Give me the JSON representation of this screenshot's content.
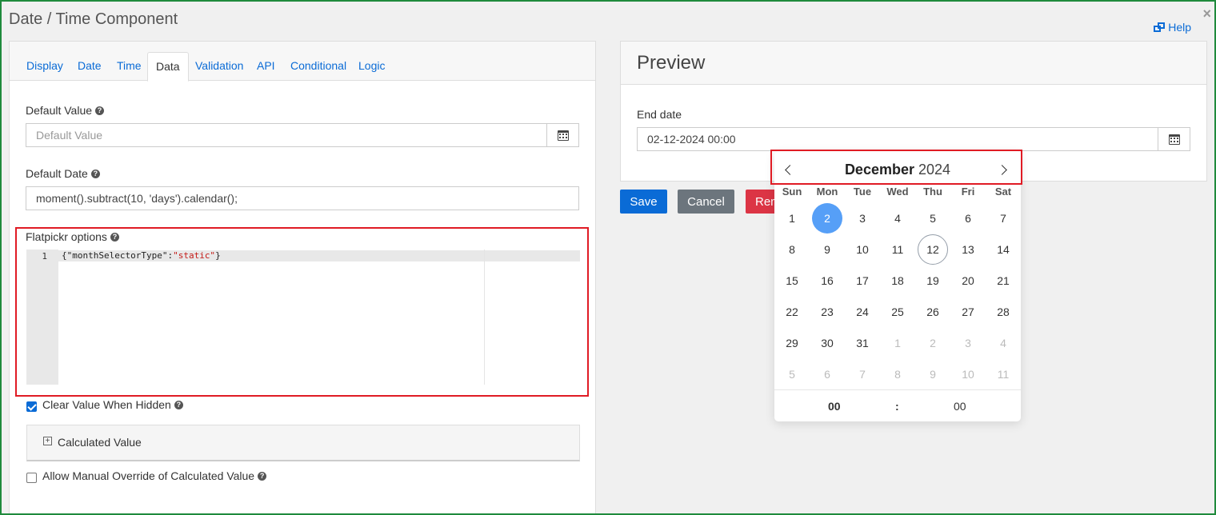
{
  "dialog": {
    "title": "Date / Time Component",
    "help_label": "Help",
    "close_glyph": "×"
  },
  "tabs": [
    {
      "label": "Display",
      "active": false
    },
    {
      "label": "Date",
      "active": false
    },
    {
      "label": "Time",
      "active": false
    },
    {
      "label": "Data",
      "active": true
    },
    {
      "label": "Validation",
      "active": false
    },
    {
      "label": "API",
      "active": false
    },
    {
      "label": "Conditional",
      "active": false
    },
    {
      "label": "Logic",
      "active": false
    }
  ],
  "fields": {
    "default_value": {
      "label": "Default Value",
      "placeholder": "Default Value"
    },
    "default_date": {
      "label": "Default Date",
      "value": "moment().subtract(10, 'days').calendar();"
    },
    "flatpickr": {
      "label": "Flatpickr options",
      "line_number": "1",
      "code_prefix": "{\"monthSelectorType\":",
      "code_string": "\"static\"",
      "code_suffix": "}"
    },
    "clear_value": {
      "label": "Clear Value When Hidden",
      "checked": true
    },
    "calculated_value": {
      "label": "Calculated Value",
      "glyph": "+"
    },
    "allow_override": {
      "label": "Allow Manual Override of Calculated Value",
      "checked": false
    }
  },
  "preview": {
    "title": "Preview",
    "end_date_label": "End date",
    "end_date_value": "02-12-2024 00:00",
    "buttons": {
      "save": "Save",
      "cancel": "Cancel",
      "remove": "Rem"
    }
  },
  "calendar": {
    "month": "December",
    "year": "2024",
    "weekdays": [
      "Sun",
      "Mon",
      "Tue",
      "Wed",
      "Thu",
      "Fri",
      "Sat"
    ],
    "days": [
      [
        "1",
        "2",
        "3",
        "4",
        "5",
        "6",
        "7"
      ],
      [
        "8",
        "9",
        "10",
        "11",
        "12",
        "13",
        "14"
      ],
      [
        "15",
        "16",
        "17",
        "18",
        "19",
        "20",
        "21"
      ],
      [
        "22",
        "23",
        "24",
        "25",
        "26",
        "27",
        "28"
      ],
      [
        "29",
        "30",
        "31",
        "1",
        "2",
        "3",
        "4"
      ],
      [
        "5",
        "6",
        "7",
        "8",
        "9",
        "10",
        "11"
      ]
    ],
    "selected": "2",
    "today": "12",
    "time": {
      "hour": "00",
      "separator": ":",
      "minute": "00"
    }
  },
  "colors": {
    "accent": "#0a6bd6",
    "save": "#0a6bd6",
    "cancel": "#6c757d",
    "remove": "#dc3545",
    "highlight": "#e01b24",
    "selected_day": "#569ff7"
  }
}
